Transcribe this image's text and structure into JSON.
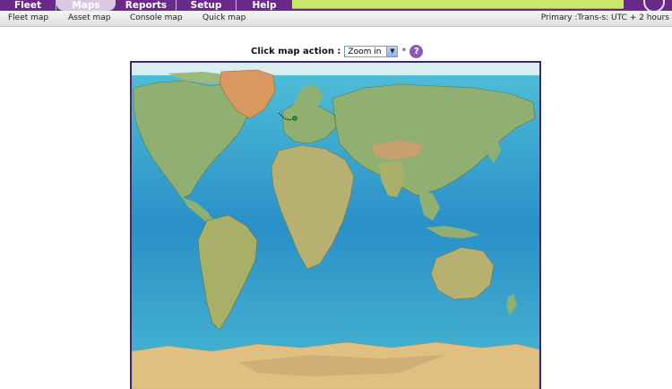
{
  "tabs": [
    {
      "label": "Fleet"
    },
    {
      "label": "Maps"
    },
    {
      "label": "Reports"
    },
    {
      "label": "Setup"
    },
    {
      "label": "Help"
    }
  ],
  "submenu": [
    {
      "label": "Fleet map"
    },
    {
      "label": "Asset map"
    },
    {
      "label": "Console map"
    },
    {
      "label": "Quick map"
    }
  ],
  "timezone": "Primary :Trans-s: UTC + 2 hours",
  "map_action": {
    "label": "Click map action :",
    "selected": "Zoom in",
    "star": "*",
    "help": "?"
  },
  "icons": {
    "help": "question-icon",
    "dropdown": "chevron-down-icon"
  },
  "colors": {
    "tabbar": "#6a2a8a",
    "accent": "#c8e86a",
    "ocean": "#3aa8c8",
    "land": "#8fb070"
  }
}
